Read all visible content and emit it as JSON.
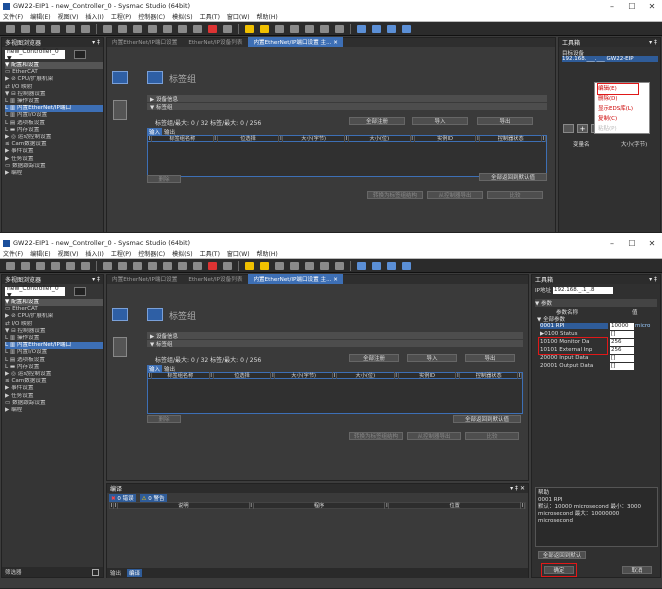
{
  "title": "GW22-EIP1 - new_Controller_0 - Sysmac Studio (64bit)",
  "menu": [
    "文件(F)",
    "编辑(E)",
    "视图(V)",
    "插入(I)",
    "工程(P)",
    "控制器(C)",
    "模拟(S)",
    "工具(T)",
    "窗口(W)",
    "帮助(H)"
  ],
  "window_buttons": [
    "–",
    "☐",
    "✕"
  ],
  "multiview": {
    "title": "多视图浏览器",
    "pin": "▾ ‡",
    "controller": "new_Controller_0 ▼"
  },
  "tree": [
    "▼ 配置和设置",
    "   ▭ EtherCAT",
    " ▶ ⊘ CPU/扩展机架",
    "   ⇄ I/O 映射",
    " ▼ ⊟ 控制器设置",
    "    L ▥ 操作设置",
    "    L ▥ 内置EtherNet/IP端口",
    "    L ▥ 内置I/O设置",
    "    L ▤ 选项板设置",
    "    L ▬ 内存设置",
    " ▶ ◎ 运动控制设置",
    "   ≤ Cam数据设置",
    "   ▶ 事件设置",
    "   ▶ 任务设置",
    "   ▭ 数据跟踪设置",
    "▶ 编程"
  ],
  "tree_selected": 6,
  "tabs": [
    "内置EtherNet/IP端口设置",
    "EtherNet/IP设备列表",
    "内置EtherNet/IP端口设置 主... ✕"
  ],
  "editor": {
    "title": "标签组",
    "section1": "▶ 设备信息",
    "section2": "▼ 标签组",
    "counts": "标签组/最大:  0 / 32    标签/最大:  0 / 256",
    "btn_register_all": "全部注册",
    "btn_import": "导入",
    "btn_export": "导出",
    "tab_input": "输入",
    "tab_output": "输出",
    "cols": [
      "I",
      "标签组名称",
      "I",
      "位选择",
      "I",
      "大小(字节)",
      "I",
      "大小(位)",
      "I",
      "实例ID",
      "I",
      "控制器状态",
      "I"
    ],
    "btn_delete": "删除",
    "btn_restore_all": "全部返回到默认值",
    "btn_bottom1": "转换为标签组结构",
    "btn_bottom2": "从控制器导出",
    "btn_bottom3": "比较"
  },
  "toolbox1": {
    "title": "工具箱",
    "pin": "▾ ‡",
    "target_label": "目标设备",
    "target_item": "192.168.___.___ GW22-EIP",
    "context_menu": [
      "编辑(E)",
      "删除(D)",
      "显示EDS库(L)",
      "复制(C)",
      "粘贴(P)"
    ],
    "col1": "变量名",
    "col2": "大小(字节)"
  },
  "toolbox2": {
    "title": "工具箱",
    "pin": "▾ ‡",
    "ip_label": "IP地址",
    "ip_value": "192.168._.1_.8",
    "params_label": "▼ 参数",
    "params_col": "参数名称",
    "params_col2": "值",
    "all_params": "▼ 全部参数",
    "rows": [
      {
        "name": "0001 RPI",
        "value": "10000",
        "unit": "micro"
      },
      {
        "name": "▶0100 Status",
        "value": "[]",
        "unit": ""
      },
      {
        "name": "10100 Monitor Da",
        "value": "256",
        "unit": ""
      },
      {
        "name": "10101 External Inp",
        "value": "256",
        "unit": ""
      },
      {
        "name": "20000 Input Data",
        "value": "[]",
        "unit": ""
      },
      {
        "name": "20001 Output Data",
        "value": "[]",
        "unit": ""
      }
    ],
    "help_title": "帮助",
    "help_line1": "0001 RPI",
    "help_line2": "默认：10000 microsecond  最小：3000",
    "help_line3": "microsecond  最大：10000000",
    "help_line4": "microsecond",
    "btn_restore": "全部返回到默认",
    "btn_ok": "确定",
    "btn_cancel": "取消"
  },
  "output": {
    "title": "编译",
    "pin": "▾ ‡ ✕",
    "err_badge": "0 错误",
    "warn_badge": "0 警告",
    "cols": [
      "I",
      "I",
      "说明",
      "I",
      "程序",
      "I",
      "位置",
      "I"
    ],
    "tab_output": "输出",
    "tab_build": "编译"
  },
  "filter_label": "筛选器"
}
